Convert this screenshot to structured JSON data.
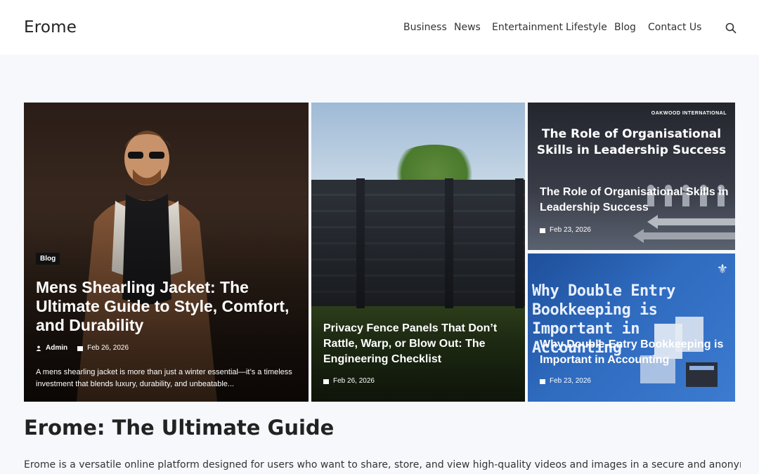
{
  "header": {
    "logo": "Erome",
    "nav": [
      "Business",
      "News",
      "Entertainment",
      "Lifestyle",
      "Blog",
      "Contact Us"
    ],
    "search_icon": "search-icon"
  },
  "featured": [
    {
      "category": "Blog",
      "title": "Mens Shearling Jacket: The Ultimate Guide to Style, Comfort, and Durability",
      "author": "Admin",
      "date": "Feb 26, 2026",
      "excerpt": "A mens shearling jacket is more than just a winter essential—it’s a timeless investment that blends luxury, durability, and unbeatable..."
    },
    {
      "title": "Privacy Fence Panels That Don’t Rattle, Warp, or Blow Out: The Engineering Checklist",
      "date": "Feb 26, 2026"
    },
    {
      "image_text": "The Role of Organisational Skills in Leadership Success",
      "image_brand": "OAKWOOD INTERNATIONAL",
      "title": "The Role of Organisational Skills in Leadership Success",
      "date": "Feb 23, 2026"
    },
    {
      "image_text": "Why Double Entry Bookkeeping is Important in Accounting",
      "title": "Why Double-Entry Bookkeeping is Important in Accounting",
      "date": "Feb 23, 2026"
    }
  ],
  "article": {
    "heading": "Erome: The Ultimate Guide",
    "intro": "Erome is a versatile online platform designed for users who want to share, store, and view high-quality videos and images in a secure and anonymous"
  }
}
